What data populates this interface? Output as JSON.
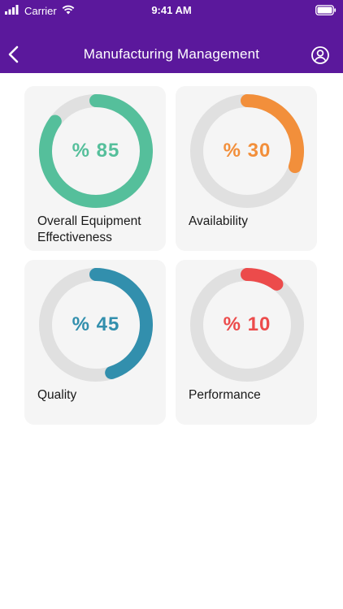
{
  "status_bar": {
    "carrier": "Carrier",
    "time": "9:41 AM"
  },
  "header": {
    "title": "Manufacturing Management",
    "background": "#5b189c"
  },
  "metrics": [
    {
      "label": "Overall Equipment Effectiveness",
      "percent_text": "% 85",
      "value": 85,
      "color": "#55bf9b"
    },
    {
      "label": "Availability",
      "percent_text": "% 30",
      "value": 30,
      "color": "#f28f3b"
    },
    {
      "label": "Quality",
      "percent_text": "% 45",
      "value": 45,
      "color": "#328fad"
    },
    {
      "label": "Performance",
      "percent_text": "% 10",
      "value": 10,
      "color": "#ec4b4b"
    }
  ],
  "ring_track_color": "#e0e0e0"
}
